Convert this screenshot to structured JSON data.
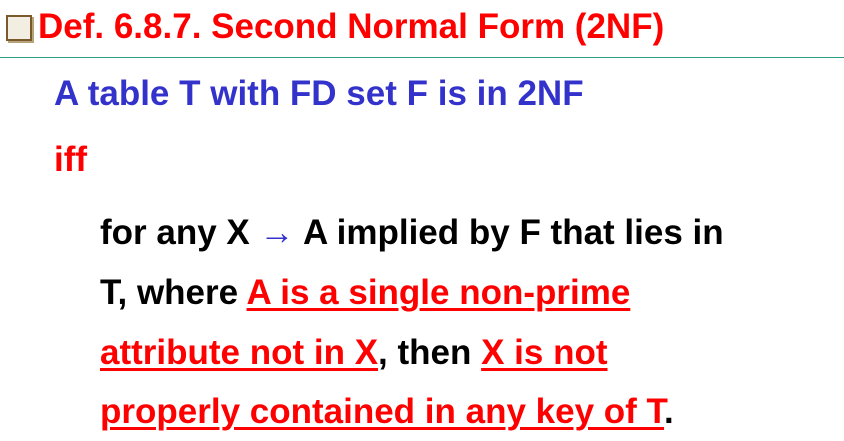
{
  "title": {
    "text": "Def. 6.8.7. Second Normal Form (2NF)"
  },
  "definition": {
    "statement": "A table T with FD set F is in 2NF",
    "iff": "iff",
    "line1": {
      "a": "for any X",
      "arrow": "→",
      "b": "A implied by F that lies in"
    },
    "line2": {
      "a": "T, where",
      "b": "A is a single non-prime"
    },
    "line3": {
      "a": "attribute not in X",
      "b": ", then",
      "c": "X is not"
    },
    "line4": {
      "a": "properly contained in any key of T",
      "b": "."
    }
  },
  "colors": {
    "title": "#ff0000",
    "statement": "#3333cc",
    "emphasis": "#ff0000",
    "body": "#000000",
    "rule": "#2aa08a"
  },
  "icons": [
    "square-bullet-icon"
  ]
}
